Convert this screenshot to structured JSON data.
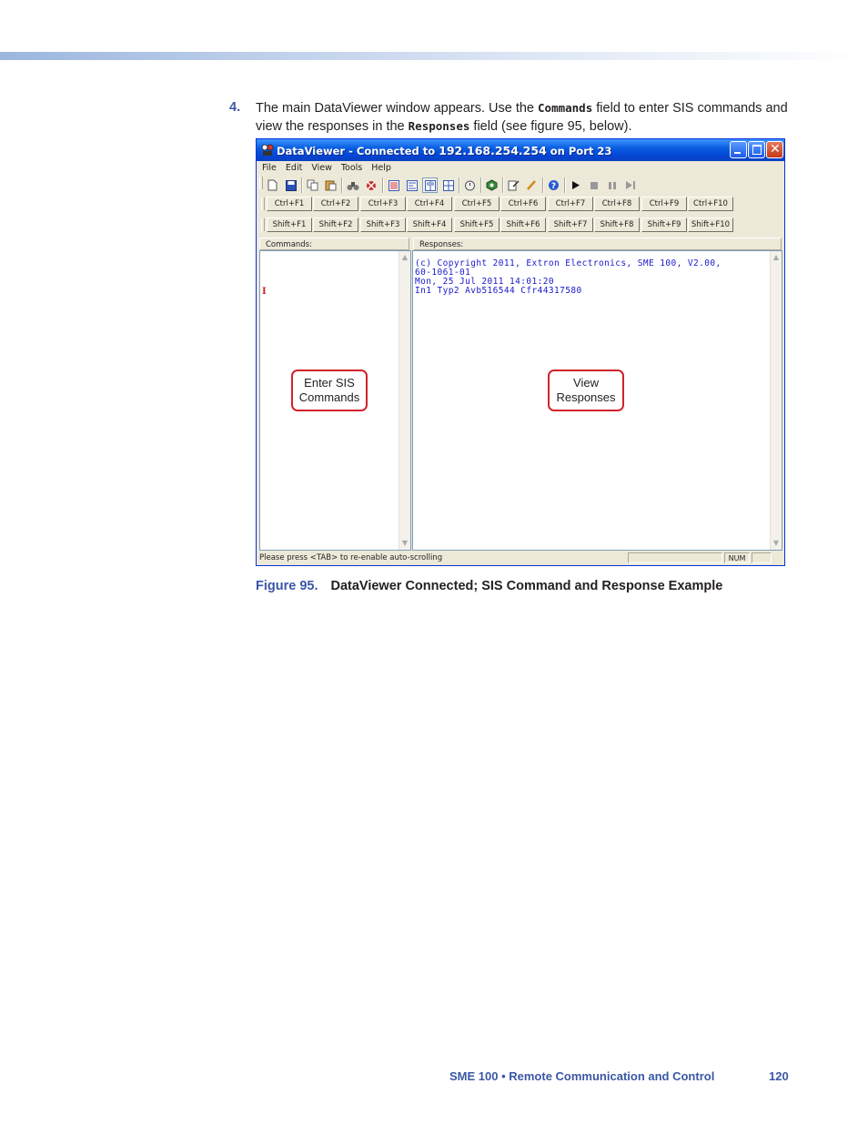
{
  "step": {
    "number": "4.",
    "text_before_commands": "The main DataViewer window appears. Use the ",
    "commands_keyword": "Commands",
    "text_middle": " field to enter SIS commands and view the responses in the ",
    "responses_keyword": "Responses",
    "text_after": " field (see figure 95, below)."
  },
  "window": {
    "title_app": "DataViewer",
    "title_status": " - Connected to ",
    "title_ip": "192.168.254.254",
    "title_port": " on Port 23",
    "menu": [
      "File",
      "Edit",
      "View",
      "Tools",
      "Help"
    ],
    "toolbar_icons": [
      "new-file-icon",
      "save-icon",
      "copy-icon",
      "paste-icon",
      "binoculars-icon",
      "connect-icon",
      "text-view-icon",
      "hex-view-icon",
      "split-view-icon",
      "grid-view-icon",
      "stopwatch-icon",
      "settings-gem-icon",
      "edit-icon",
      "brush-icon",
      "help-icon",
      "play-icon",
      "stop-icon",
      "pause-icon",
      "step-icon"
    ],
    "ctrl_keys": [
      "Ctrl+F1",
      "Ctrl+F2",
      "Ctrl+F3",
      "Ctrl+F4",
      "Ctrl+F5",
      "Ctrl+F6",
      "Ctrl+F7",
      "Ctrl+F8",
      "Ctrl+F9",
      "Ctrl+F10"
    ],
    "shift_keys": [
      "Shift+F1",
      "Shift+F2",
      "Shift+F3",
      "Shift+F4",
      "Shift+F5",
      "Shift+F6",
      "Shift+F7",
      "Shift+F8",
      "Shift+F9",
      "Shift+F10"
    ],
    "commands_label": "Commands:",
    "responses_label": "Responses:",
    "responses_lines": [
      "(c) Copyright 2011, Extron Electronics, SME 100, V2.00,",
      "60-1061-01",
      "Mon, 25 Jul 2011 14:01:20",
      "In1 Typ2 Avb516544 Cfr44317580"
    ],
    "status_text": "Please press <TAB> to re-enable auto-scrolling",
    "status_num": "NUM"
  },
  "callouts": {
    "commands": "Enter SIS Commands",
    "responses": "View Responses"
  },
  "caption": {
    "figure": "Figure 95.",
    "title": "DataViewer Connected; SIS Command and Response Example"
  },
  "footer": {
    "title": "SME 100 • Remote Communication and Control",
    "page": "120"
  }
}
